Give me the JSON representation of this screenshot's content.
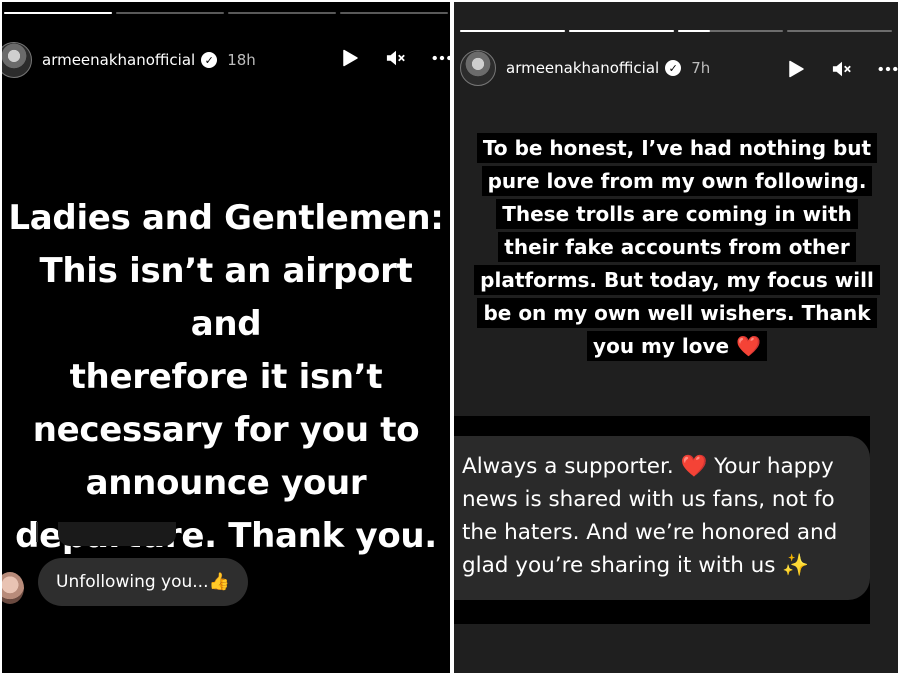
{
  "left_story": {
    "username": "armeenakhanofficial",
    "time": "18h",
    "progress": [
      1,
      0,
      0,
      0
    ],
    "message": [
      "Ladies and Gentlemen:",
      "This isn’t an airport and",
      "therefore it isn’t",
      "necessary for you to",
      "announce your",
      "departure.  Thank you."
    ],
    "reply": "Unfollowing you...👍"
  },
  "right_story": {
    "username": "armeenakhanofficial",
    "time": "7h",
    "progress": [
      1,
      1,
      0.3,
      0
    ],
    "message": [
      "To be honest, I’ve had nothing but",
      "pure love from my own following.",
      "These trolls are coming in with",
      "their fake accounts from other",
      "platforms. But today, my focus will",
      "be on my own well wishers. Thank",
      "you my love ❤️"
    ],
    "comment": [
      "Always a supporter. ❤️  Your happy",
      "news is shared with us fans, not fo",
      "the haters. And we’re honored and",
      "glad you’re sharing it with us ✨"
    ]
  },
  "icons": {
    "play": "play-icon",
    "mute": "mute-icon",
    "more": "more-icon",
    "verified": "verified-badge-icon"
  }
}
